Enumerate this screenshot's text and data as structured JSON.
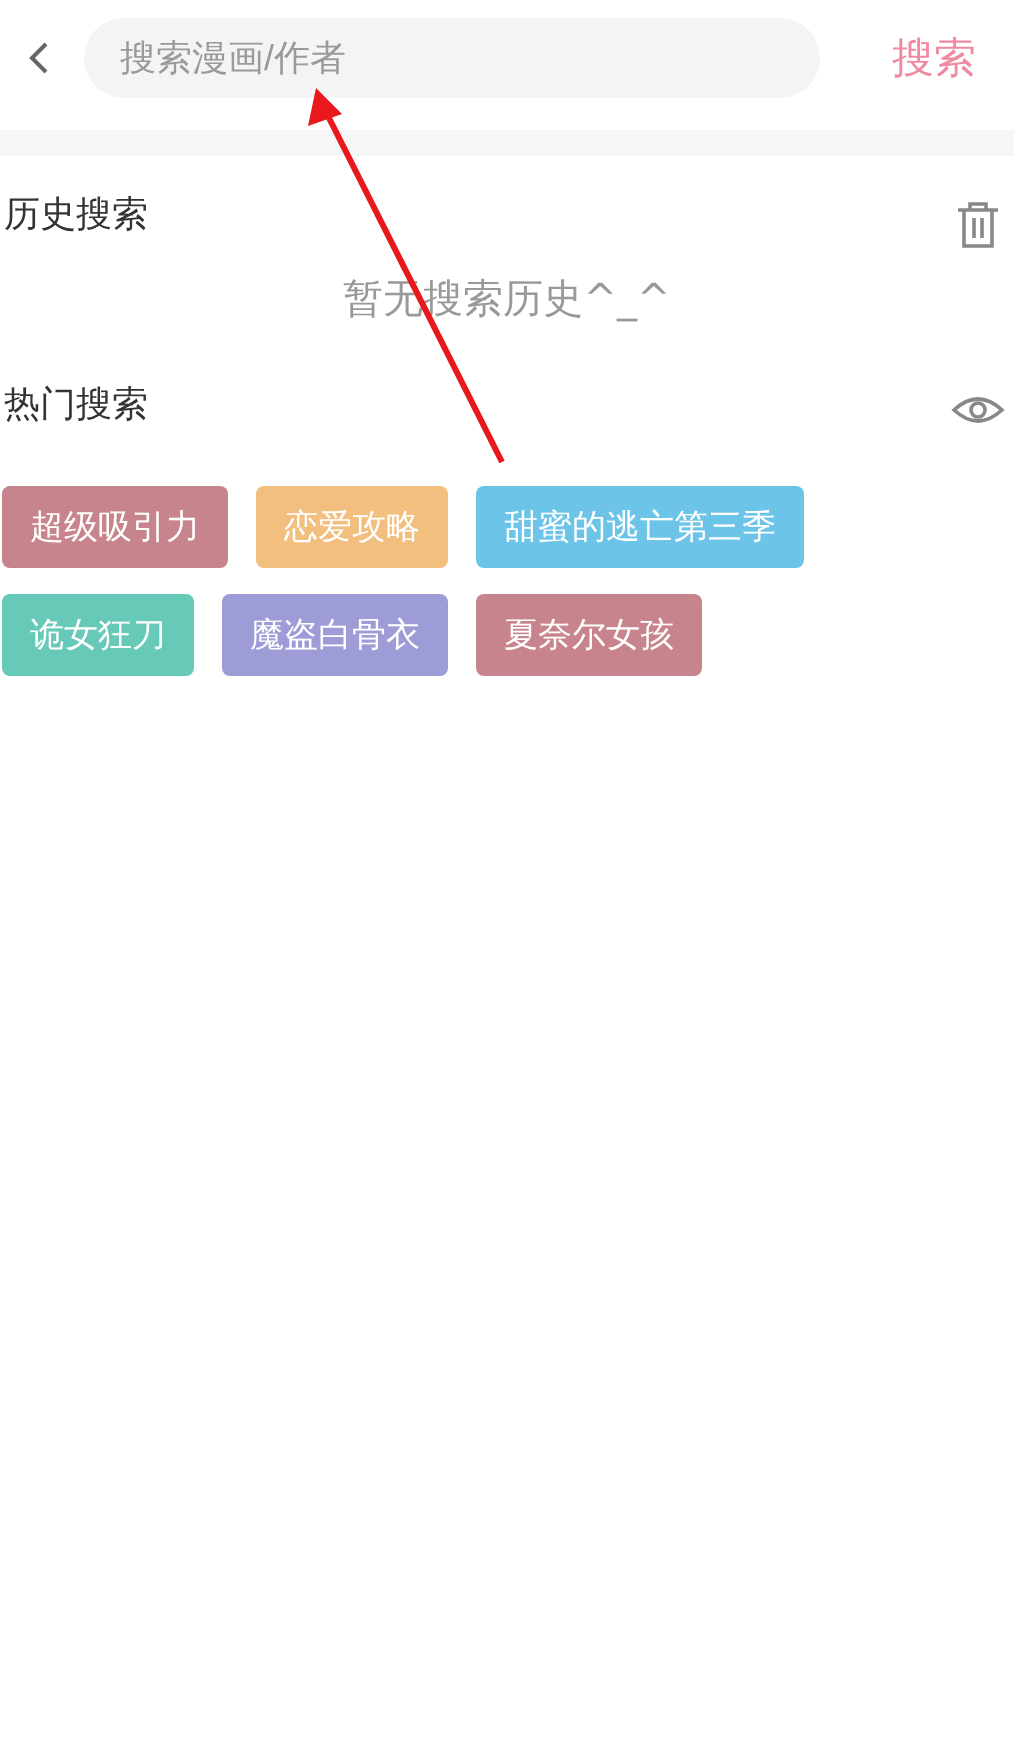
{
  "search": {
    "placeholder": "搜索漫画/作者",
    "button": "搜索"
  },
  "history": {
    "title": "历史搜索",
    "empty": "暂无搜索历史^_^"
  },
  "hot": {
    "title": "热门搜索",
    "tags": [
      {
        "label": "超级吸引力",
        "color": "#c8848c"
      },
      {
        "label": "恋爱攻略",
        "color": "#f2bf7e"
      },
      {
        "label": "甜蜜的逃亡第三季",
        "color": "#6cc5e8"
      },
      {
        "label": "诡女狂刀",
        "color": "#67c9b8"
      },
      {
        "label": "魔盗白骨衣",
        "color": "#9e9cd6"
      },
      {
        "label": "夏奈尔女孩",
        "color": "#c8848c"
      }
    ]
  }
}
